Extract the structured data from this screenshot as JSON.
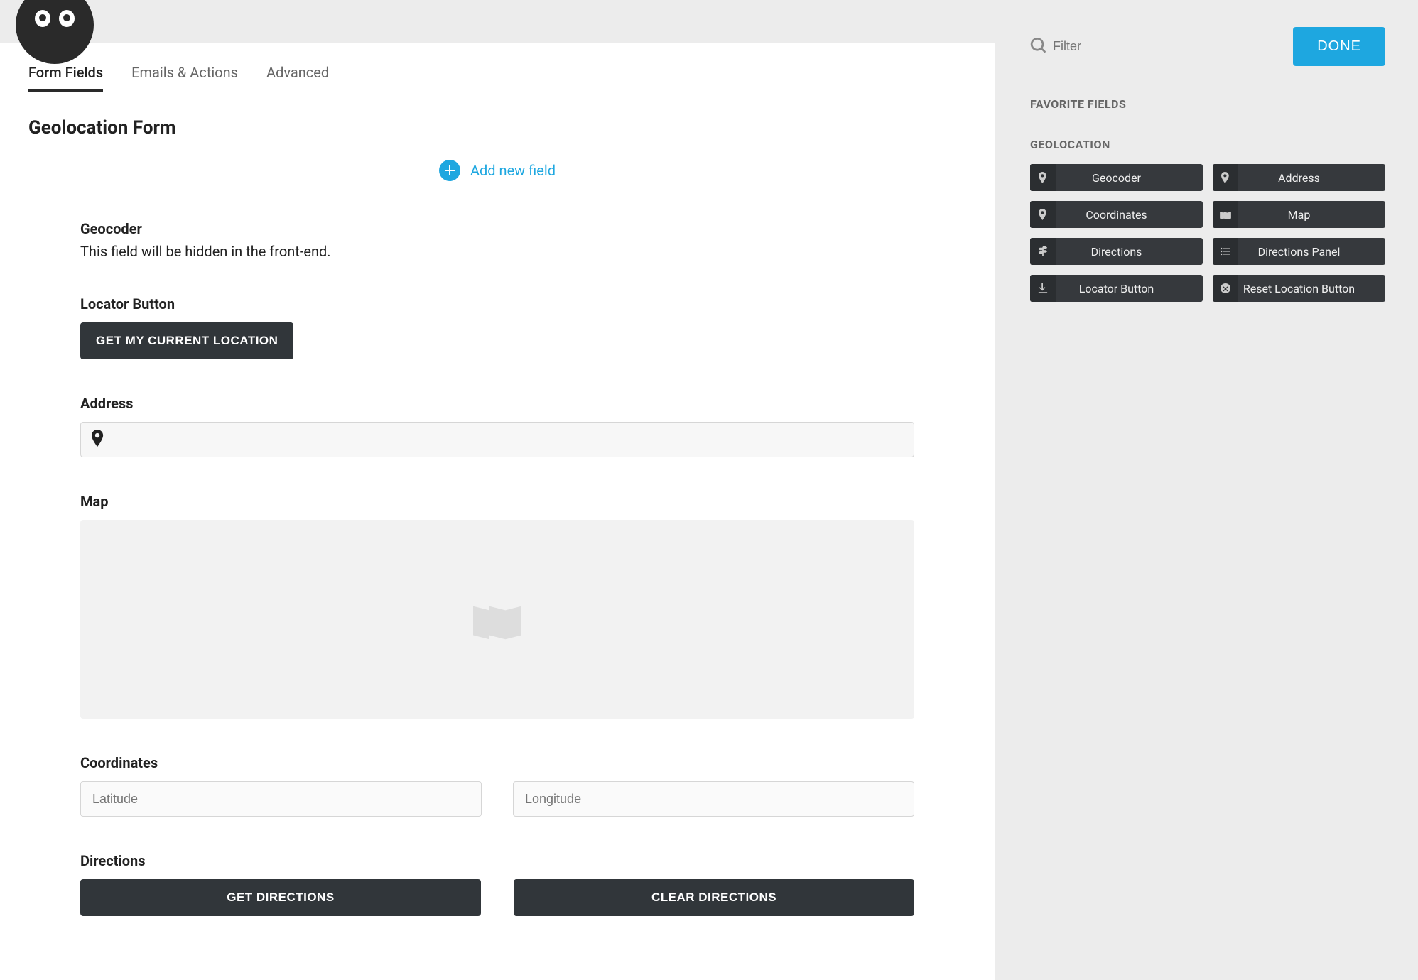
{
  "tabs": {
    "form_fields": "Form Fields",
    "emails_actions": "Emails & Actions",
    "advanced": "Advanced"
  },
  "form_title": "Geolocation Form",
  "add_new_field": "Add new field",
  "form": {
    "geocoder": {
      "label": "Geocoder",
      "desc": "This field will be hidden in the front-end."
    },
    "locator": {
      "label": "Locator Button",
      "button": "GET MY CURRENT LOCATION"
    },
    "address": {
      "label": "Address",
      "value": ""
    },
    "map": {
      "label": "Map"
    },
    "coordinates": {
      "label": "Coordinates",
      "lat_placeholder": "Latitude",
      "lng_placeholder": "Longitude"
    },
    "directions": {
      "label": "Directions",
      "get": "GET DIRECTIONS",
      "clear": "CLEAR DIRECTIONS"
    }
  },
  "sidebar": {
    "filter_placeholder": "Filter",
    "done": "DONE",
    "favorite_header": "FAVORITE FIELDS",
    "geo_header": "GEOLOCATION",
    "chips": {
      "geocoder": "Geocoder",
      "address": "Address",
      "coordinates": "Coordinates",
      "map": "Map",
      "directions": "Directions",
      "directions_panel": "Directions Panel",
      "locator_button": "Locator Button",
      "reset_location": "Reset Location Button"
    }
  }
}
